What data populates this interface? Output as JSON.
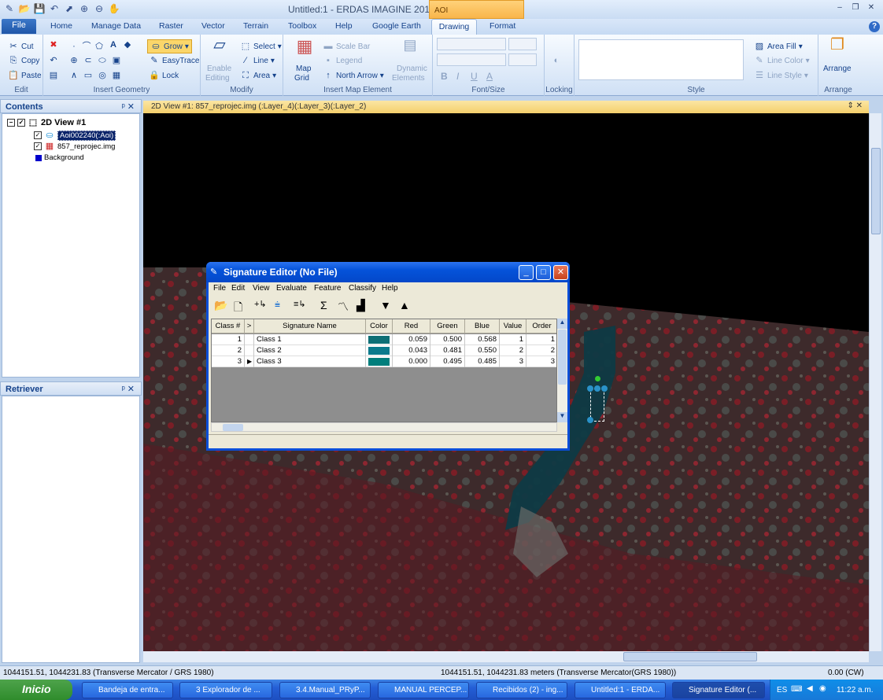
{
  "window": {
    "title": "Untitled:1 - ERDAS IMAGINE 2011",
    "context_tab": "AOI"
  },
  "tabs": [
    "File",
    "Home",
    "Manage Data",
    "Raster",
    "Vector",
    "Terrain",
    "Toolbox",
    "Help",
    "Google Earth",
    "Drawing",
    "Format"
  ],
  "ribbon": {
    "edit": {
      "cut": "Cut",
      "copy": "Copy",
      "paste": "Paste",
      "label": "Edit"
    },
    "insert_geometry": {
      "grow": "Grow",
      "easytrace": "EasyTrace",
      "lock": "Lock",
      "label": "Insert Geometry"
    },
    "modify": {
      "enable": "Enable",
      "editing": "Editing",
      "select": "Select",
      "line": "Line",
      "area": "Area",
      "label": "Modify"
    },
    "insert_map": {
      "map": "Map",
      "grid": "Grid",
      "scale_bar": "Scale Bar",
      "legend": "Legend",
      "north_arrow": "North Arrow",
      "dynamic": "Dynamic",
      "elements": "Elements",
      "label": "Insert Map Element"
    },
    "font": {
      "bold": "B",
      "italic": "I",
      "underline": "U",
      "color": "A",
      "label": "Font/Size"
    },
    "locking": {
      "label": "Locking"
    },
    "style": {
      "area_fill": "Area Fill",
      "line_color": "Line Color",
      "line_style": "Line Style",
      "label": "Style"
    },
    "arrange": {
      "arrange": "Arrange",
      "label": "Arrange"
    }
  },
  "contents": {
    "title": "Contents",
    "root": "2D View #1",
    "layers": [
      "Aoi002240(:Aoi)",
      "857_reprojec.img",
      "Background"
    ]
  },
  "retriever": {
    "title": "Retriever"
  },
  "view": {
    "title": "2D View #1: 857_reprojec.img (:Layer_4)(:Layer_3)(:Layer_2)"
  },
  "dialog": {
    "title": "Signature Editor (No File)",
    "menu": [
      "File",
      "Edit",
      "View",
      "Evaluate",
      "Feature",
      "Classify",
      "Help"
    ],
    "columns": [
      "Class #",
      ">",
      "Signature Name",
      "Color",
      "Red",
      "Green",
      "Blue",
      "Value",
      "Order"
    ],
    "rows": [
      {
        "num": "1",
        "mark": "",
        "name": "Class 1",
        "color": "#0e6f76",
        "red": "0.059",
        "green": "0.500",
        "blue": "0.568",
        "value": "1",
        "order": "1"
      },
      {
        "num": "2",
        "mark": "",
        "name": "Class 2",
        "color": "#0b7a8c",
        "red": "0.043",
        "green": "0.481",
        "blue": "0.550",
        "value": "2",
        "order": "2"
      },
      {
        "num": "3",
        "mark": "▶",
        "name": "Class 3",
        "color": "#007e7c",
        "red": "0.000",
        "green": "0.495",
        "blue": "0.485",
        "value": "3",
        "order": "3"
      }
    ]
  },
  "status": {
    "left": "1044151.51, 1044231.83  (Transverse Mercator / GRS 1980)",
    "mid": "1044151.51, 1044231.83 meters (Transverse Mercator(GRS 1980))",
    "right": "0.00 (CW)"
  },
  "taskbar": {
    "start": "Inicio",
    "items": [
      "Bandeja de entra...",
      "3 Explorador de ...",
      "3.4.Manual_PRyP...",
      "MANUAL PERCEP...",
      "Recibidos (2) - ing...",
      "Untitled:1 - ERDA...",
      "Signature Editor (..."
    ],
    "lang": "ES",
    "time": "11:22 a.m."
  }
}
